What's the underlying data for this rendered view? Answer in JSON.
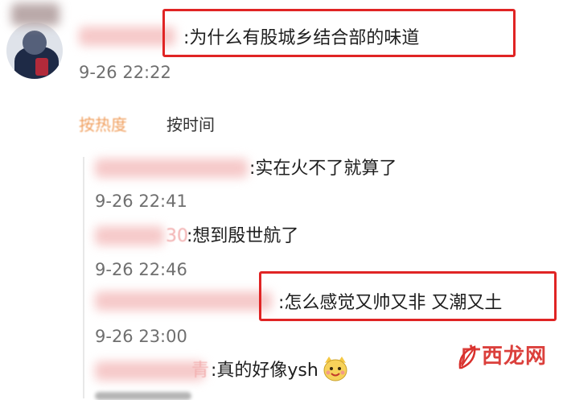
{
  "colors": {
    "highlight_border": "#e02424",
    "hot_tab": "#f0a060",
    "timestamp": "#6f6f6f",
    "redacted_pink": "#f6c9c9",
    "watermark_red": "#d9302c"
  },
  "post": {
    "comment": ":为什么有股城乡结合部的味道",
    "time": "9-26 22:22"
  },
  "sort": {
    "hot_label": "按热度",
    "time_label": "按时间"
  },
  "replies": [
    {
      "prefix": "",
      "text": ":实在火不了就算了",
      "time": "9-26 22:41"
    },
    {
      "prefix": "30",
      "text": ":想到殷世航了",
      "time": "9-26 22:46"
    },
    {
      "prefix": "",
      "text": ":怎么感觉又帅又非 又潮又土",
      "time": "9-26 23:00"
    },
    {
      "prefix": "青",
      "text": ":真的好像ysh",
      "time": ""
    }
  ],
  "watermark": {
    "brand": "广西龙网",
    "icon": "leaf-logo-icon"
  }
}
